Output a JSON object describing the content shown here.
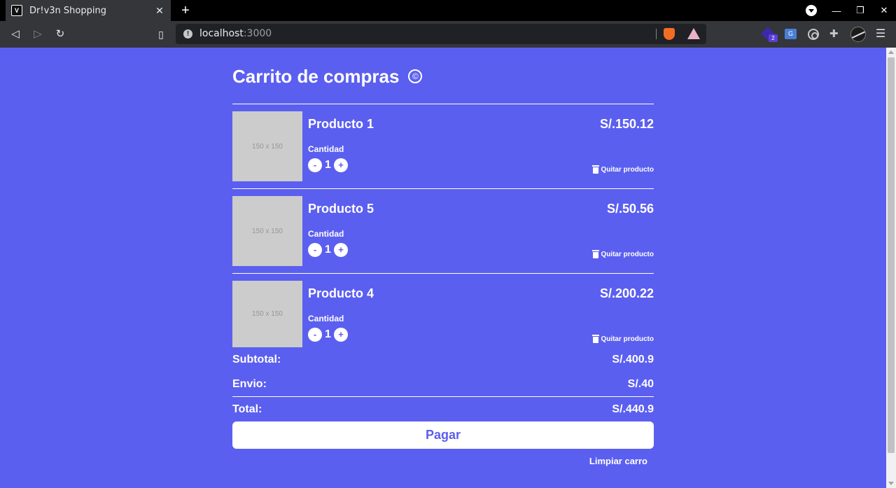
{
  "browser": {
    "tab_title": "Dr!v3n Shopping",
    "favicon_letter": "V",
    "new_tab": "+",
    "close_tab": "✕",
    "url_host": "localhost",
    "url_port": ":3000",
    "ext_badge": "2",
    "translate_label": "G"
  },
  "cart": {
    "title": "Carrito de compras",
    "qty_label": "Cantidad",
    "remove_label": "Quitar producto",
    "items": [
      {
        "name": "Producto 1",
        "price": "S/.150.12",
        "quantity": "1",
        "image_placeholder": "150 x 150"
      },
      {
        "name": "Producto 5",
        "price": "S/.50.56",
        "quantity": "1",
        "image_placeholder": "150 x 150"
      },
      {
        "name": "Producto 4",
        "price": "S/.200.22",
        "quantity": "1",
        "image_placeholder": "150 x 150"
      }
    ],
    "decrease": "-",
    "increase": "+",
    "subtotal_label": "Subtotal:",
    "subtotal_value": "S/.400.9",
    "shipping_label": "Envio:",
    "shipping_value": "S/.40",
    "total_label": "Total:",
    "total_value": "S/.440.9",
    "pay_label": "Pagar",
    "clear_label": "Limpiar carro"
  },
  "colors": {
    "page_background": "#5b5fef",
    "accent_text": "#5b5fef",
    "image_placeholder_bg": "#cccccc"
  }
}
